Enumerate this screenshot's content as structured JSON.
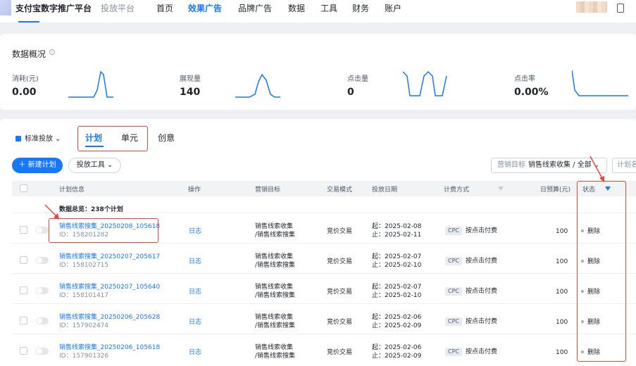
{
  "topnav": {
    "brand": "支付宝数字推广平台",
    "sub": "投放平台",
    "items": [
      "首页",
      "效果广告",
      "品牌广告",
      "数据",
      "工具",
      "财务",
      "账户"
    ],
    "active_index": 1
  },
  "overview": {
    "title": "数据概况",
    "metrics": [
      {
        "label": "消耗(元)",
        "value": "0.00"
      },
      {
        "label": "展现量",
        "value": "140"
      },
      {
        "label": "点击量",
        "value": "0"
      },
      {
        "label": "点击率",
        "value": "0.00%"
      }
    ],
    "accent": "#1677ff"
  },
  "toolbar": {
    "standard": "标准投放",
    "tabs": [
      "计划",
      "单元",
      "创意"
    ],
    "new_plan": "新建计划",
    "tools": "投放工具",
    "filter_label": "营销目标",
    "filter_value": "销售线索收集 / 全部",
    "filter2": "计划名"
  },
  "table": {
    "headers": [
      "计划信息",
      "操作",
      "营销目标",
      "交易模式",
      "投放日期",
      "计费方式",
      "日预算(元)",
      "状态"
    ],
    "summary": "数据总览：238个计划",
    "rows": [
      {
        "name": "销售线索搜集_20250208_105618",
        "id": "ID：158201282",
        "op": "日志",
        "goal1": "销售线索收集",
        "goal2": "/销售线索搜集",
        "mode": "竞价交易",
        "start": "起：2025-02-08",
        "end": "止：2025-02-11",
        "billing": "按点击付费",
        "budget": "100",
        "status": "删除"
      },
      {
        "name": "销售线索搜集_20250207_205617",
        "id": "ID：158102715",
        "op": "日志",
        "goal1": "销售线索收集",
        "goal2": "/销售线索搜集",
        "mode": "竞价交易",
        "start": "起：2025-02-07",
        "end": "止：2025-02-10",
        "billing": "按点击付费",
        "budget": "100",
        "status": "删除"
      },
      {
        "name": "销售线索搜集_20250207_105640",
        "id": "ID：158101417",
        "op": "日志",
        "goal1": "销售线索收集",
        "goal2": "/销售线索搜集",
        "mode": "竞价交易",
        "start": "起：2025-02-07",
        "end": "止：2025-02-10",
        "billing": "按点击付费",
        "budget": "100",
        "status": "删除"
      },
      {
        "name": "销售线索搜集_20250206_205628",
        "id": "ID：157902474",
        "op": "日志",
        "goal1": "销售线索收集",
        "goal2": "/销售线索搜集",
        "mode": "竞价交易",
        "start": "起：2025-02-06",
        "end": "止：2025-02-09",
        "billing": "按点击付费",
        "budget": "100",
        "status": "删除"
      },
      {
        "name": "销售线索搜集_20250206_105618",
        "id": "ID：157901326",
        "op": "日志",
        "goal1": "销售线索收集",
        "goal2": "/销售线索搜集",
        "mode": "竞价交易",
        "start": "起：2025-02-06",
        "end": "止：2025-02-09",
        "billing": "按点击付费",
        "budget": "100",
        "status": "删除"
      }
    ],
    "cpc_tag": "CPC"
  }
}
